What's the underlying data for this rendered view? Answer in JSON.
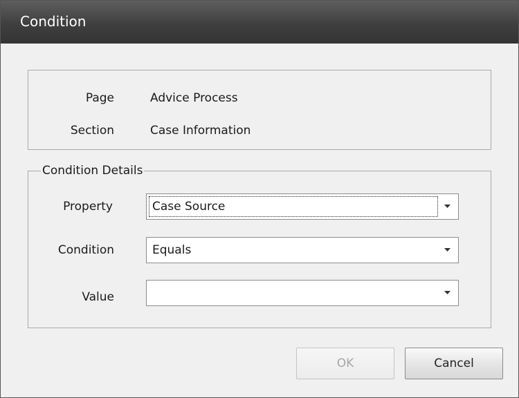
{
  "window": {
    "title": "Condition"
  },
  "info": {
    "page_label": "Page",
    "page_value": "Advice Process",
    "section_label": "Section",
    "section_value": "Case Information"
  },
  "condition_details": {
    "legend": "Condition Details",
    "property_label": "Property",
    "property_value": "Case Source",
    "condition_label": "Condition",
    "condition_value": "Equals",
    "value_label": "Value",
    "value_value": ""
  },
  "buttons": {
    "ok_label": "OK",
    "cancel_label": "Cancel"
  }
}
